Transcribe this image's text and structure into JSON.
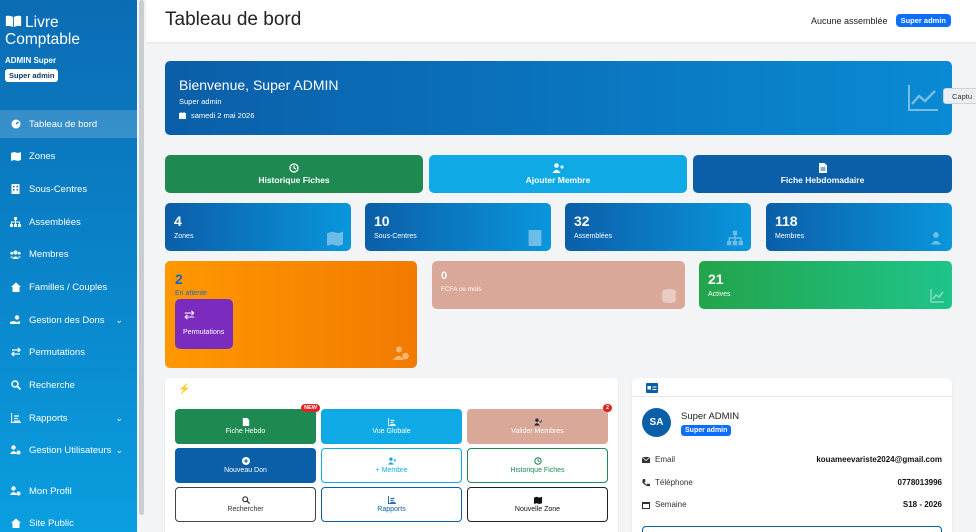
{
  "app": {
    "brand_line1": "Livre",
    "brand_line2": "Comptable",
    "user_name": "ADMIN Super",
    "user_role": "Super admin"
  },
  "sidebar": {
    "items": [
      {
        "label": "Tableau de bord",
        "icon": "dashboard-icon"
      },
      {
        "label": "Zones",
        "icon": "map-icon"
      },
      {
        "label": "Sous-Centres",
        "icon": "building-icon"
      },
      {
        "label": "Assemblées",
        "icon": "sitemap-icon"
      },
      {
        "label": "Membres",
        "icon": "users-icon"
      },
      {
        "label": "Familles / Couples",
        "icon": "home-icon"
      },
      {
        "label": "Gestion des Dons",
        "icon": "hand-coin-icon"
      },
      {
        "label": "Permutations",
        "icon": "exchange-icon"
      },
      {
        "label": "Recherche",
        "icon": "search-icon"
      },
      {
        "label": "Rapports",
        "icon": "chart-icon"
      },
      {
        "label": "Gestion Utilisateurs",
        "icon": "users-cog-icon"
      },
      {
        "label": "Mon Profil",
        "icon": "user-cog-icon"
      },
      {
        "label": "Site Public",
        "icon": "home-icon"
      }
    ]
  },
  "header": {
    "title": "Tableau de bord",
    "assembly_status": "Aucune assemblée",
    "role_badge": "Super admin"
  },
  "welcome": {
    "title": "Bienvenue, Super ADMIN",
    "role": "Super admin",
    "date": "samedi 2 mai 2026"
  },
  "overlay": {
    "capture_label": "Captu"
  },
  "actions": {
    "history": "Historique Fiches",
    "add_member": "Ajouter Membre",
    "weekly": "Fiche Hebdomadaire"
  },
  "stats": [
    {
      "value": "4",
      "label": "Zones",
      "icon": "map-icon"
    },
    {
      "value": "10",
      "label": "Sous-Centres",
      "icon": "building-icon"
    },
    {
      "value": "32",
      "label": "Assemblées",
      "icon": "sitemap-icon"
    },
    {
      "value": "118",
      "label": "Membres",
      "icon": "users-icon"
    }
  ],
  "pending": {
    "value": "2",
    "label": "En attente",
    "tile_label": "Permutations"
  },
  "fcfa": {
    "value": "0",
    "label": "FCFA ce mois"
  },
  "active": {
    "value": "21",
    "label": "Actives"
  },
  "quick": {
    "items": [
      {
        "label": "Fiche Hebdo",
        "badge": "NEW"
      },
      {
        "label": "Vue Globale"
      },
      {
        "label": "Valider Membres",
        "badge": "2"
      },
      {
        "label": "Nouveau Don"
      },
      {
        "label": "+ Membre"
      },
      {
        "label": "Historique Fiches"
      },
      {
        "label": "Rechercher"
      },
      {
        "label": "Rapports"
      },
      {
        "label": "Nouvelle Zone"
      }
    ]
  },
  "profile": {
    "initials": "SA",
    "name": "Super ADMIN",
    "role": "Super admin",
    "email_label": "Email",
    "email": "kouameevariste2024@gmail.com",
    "phone_label": "Téléphone",
    "phone": "0778013996",
    "week_label": "Semaine",
    "week": "S18 - 2026"
  }
}
